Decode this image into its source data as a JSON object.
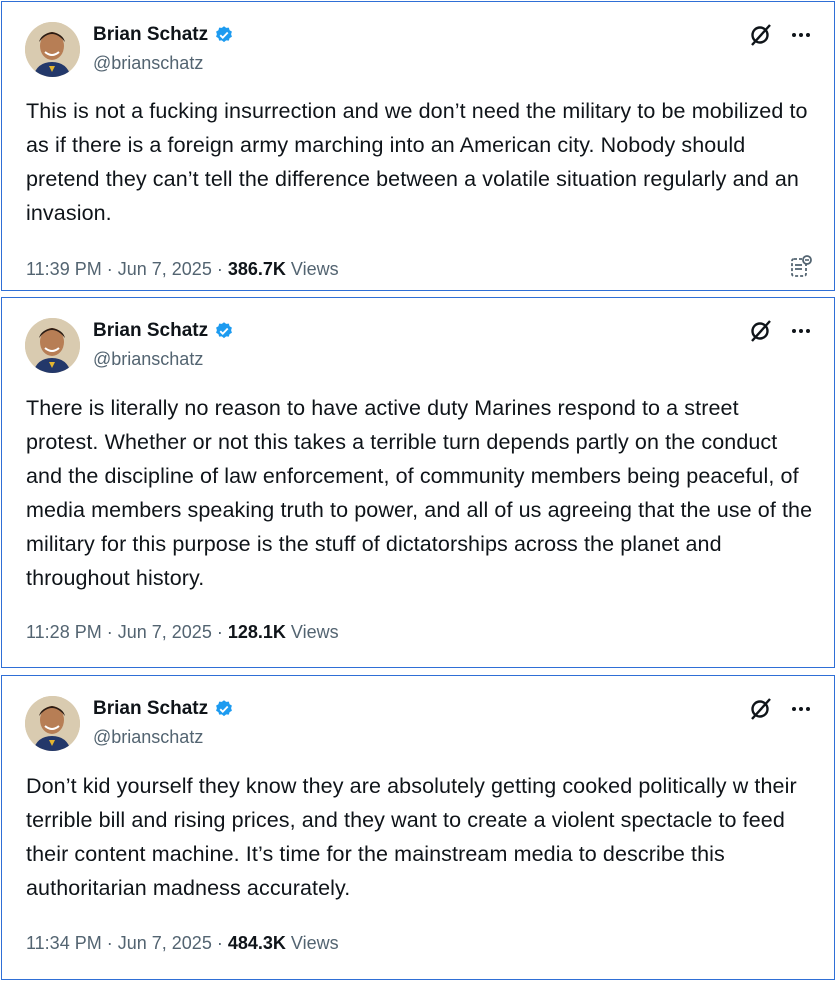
{
  "tweets": [
    {
      "name": "Brian Schatz",
      "handle": "@brianschatz",
      "text": "This is not a fucking insurrection and we don’t need the military to be mobilized to as if there is a foreign army marching into an American city. Nobody should pretend they can’t tell the difference between a volatile situation regularly and an invasion.",
      "time": "11:39 PM",
      "date": "Jun 7, 2025",
      "views_count": "386.7K",
      "views_label": "Views"
    },
    {
      "name": "Brian Schatz",
      "handle": "@brianschatz",
      "text": "There is literally no reason to have active duty Marines respond to a street protest. Whether or not this takes a terrible turn depends partly on the conduct and the discipline of law enforcement, of community members being peaceful, of media members speaking truth to power, and all of us agreeing that the use of the military for this purpose is the stuff of dictatorships across the planet and throughout history.",
      "time": "11:28 PM",
      "date": "Jun 7, 2025",
      "views_count": "128.1K",
      "views_label": "Views"
    },
    {
      "name": "Brian Schatz",
      "handle": "@brianschatz",
      "text": "Don’t kid yourself they know they are absolutely getting cooked politically w their terrible bill and rising prices, and they want to create a violent spectacle to feed their content machine. It’s time for the mainstream media to describe this authoritarian madness accurately.",
      "time": "11:34 PM",
      "date": "Jun 7, 2025",
      "views_count": "484.3K",
      "views_label": "Views"
    }
  ],
  "separator": "·",
  "colors": {
    "border": "#2f6fd6",
    "verified": "#1d9bf0",
    "text": "#0f1419",
    "secondary": "#536471"
  },
  "icons": [
    "verified-badge-icon",
    "grok-icon",
    "more-icon",
    "notes-icon"
  ]
}
